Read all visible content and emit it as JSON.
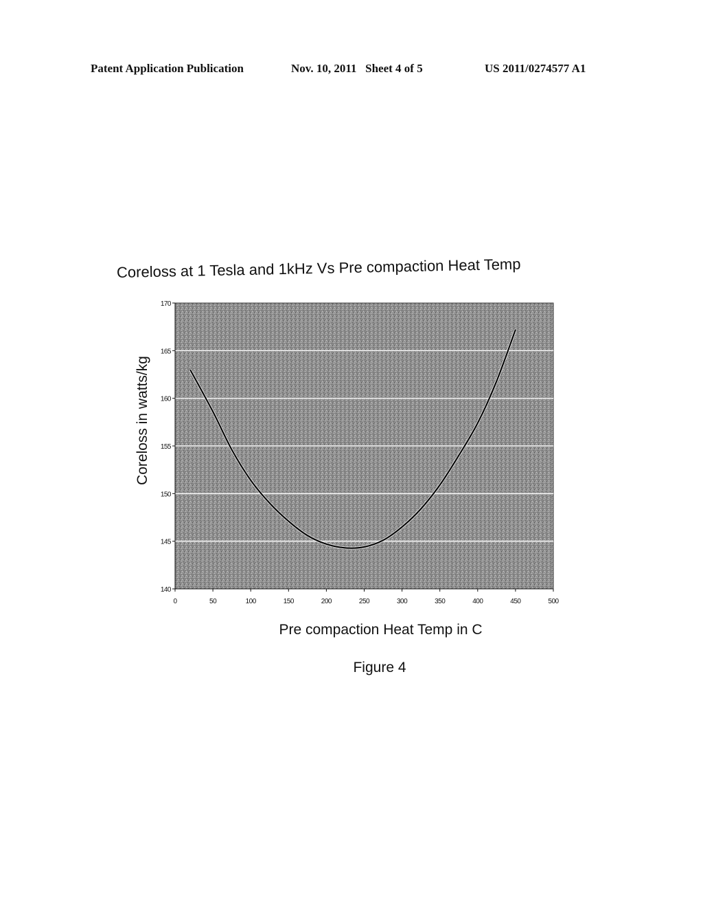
{
  "header": {
    "left": "Patent Application Publication",
    "middle": "Nov. 10, 2011   Sheet 4 of 5",
    "right": "US 2011/0274577 A1"
  },
  "figure_label": "Figure 4",
  "chart_data": {
    "type": "line",
    "title": "Coreloss at 1 Tesla and 1kHz Vs Pre compaction Heat Temp",
    "xlabel": "Pre compaction Heat Temp in C",
    "ylabel": "Coreloss in watts/kg",
    "xlim": [
      0,
      500
    ],
    "ylim": [
      140,
      170
    ],
    "x_ticks": [
      0,
      50,
      100,
      150,
      200,
      250,
      300,
      350,
      400,
      450,
      500
    ],
    "y_ticks": [
      140,
      145,
      150,
      155,
      160,
      165,
      170
    ],
    "grid": "horizontal",
    "legend": "none",
    "background": "gray textured",
    "series": [
      {
        "name": "Coreloss",
        "color": "#000000",
        "x": [
          20,
          50,
          75,
          100,
          125,
          150,
          175,
          200,
          225,
          250,
          275,
          300,
          325,
          350,
          375,
          400,
          425,
          450
        ],
        "y": [
          163.0,
          158.6,
          154.6,
          151.4,
          149.0,
          147.1,
          145.6,
          144.7,
          144.3,
          144.4,
          145.1,
          146.5,
          148.4,
          150.9,
          154.0,
          157.4,
          161.8,
          167.2
        ]
      }
    ]
  }
}
